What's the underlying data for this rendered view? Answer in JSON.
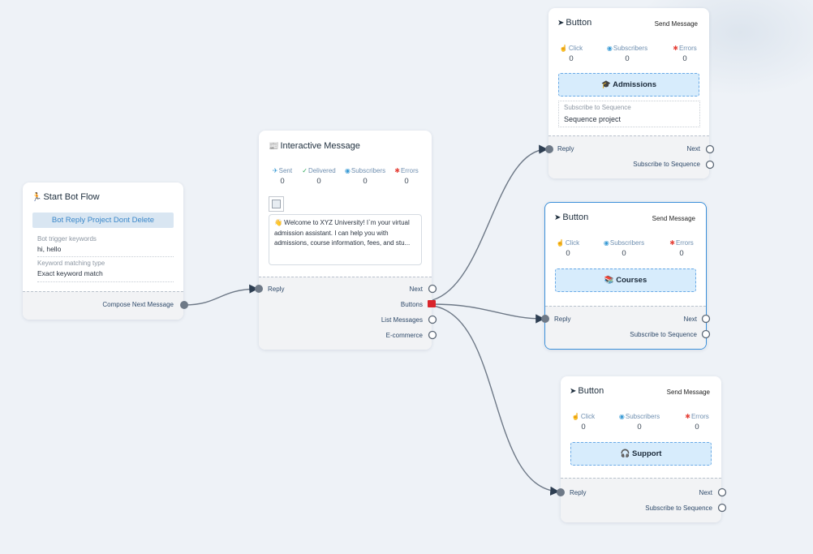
{
  "start_node": {
    "title": "Start Bot Flow",
    "icon": "walking-person-icon",
    "flow_label": "Bot Reply Project Dont Delete",
    "trigger_keywords_label": "Bot trigger keywords",
    "trigger_keywords_value": "hi, hello",
    "matching_type_label": "Keyword matching type",
    "matching_type_value": "Exact keyword match",
    "compose_next": "Compose Next Message"
  },
  "interactive_node": {
    "title": "Interactive Message",
    "icon": "newspaper-icon",
    "stats": [
      {
        "label": "Sent",
        "value": "0",
        "icon": "send-icon"
      },
      {
        "label": "Delivered",
        "value": "0",
        "icon": "check-circle-icon"
      },
      {
        "label": "Subscribers",
        "value": "0",
        "icon": "user-circle-icon"
      },
      {
        "label": "Errors",
        "value": "0",
        "icon": "bug-icon"
      }
    ],
    "message": "👋 Welcome to XYZ University! I`m your virtual admission assistant. I can help you with admissions, course information, fees, and stu...",
    "ports": {
      "reply": "Reply",
      "next": "Next",
      "buttons": "Buttons",
      "list_messages": "List Messages",
      "ecommerce": "E-commerce"
    }
  },
  "button_nodes": [
    {
      "title": "Button",
      "send_label": "Send Message",
      "button_text": "🎓 Admissions",
      "stats": [
        {
          "label": "Click",
          "value": "0"
        },
        {
          "label": "Subscribers",
          "value": "0"
        },
        {
          "label": "Errors",
          "value": "0"
        }
      ],
      "sequence_label": "Subscribe to Sequence",
      "sequence_value": "Sequence project",
      "reply": "Reply",
      "next": "Next",
      "subscribe": "Subscribe to Sequence"
    },
    {
      "title": "Button",
      "send_label": "Send Message",
      "button_text": "📚 Courses",
      "stats": [
        {
          "label": "Click",
          "value": "0"
        },
        {
          "label": "Subscribers",
          "value": "0"
        },
        {
          "label": "Errors",
          "value": "0"
        }
      ],
      "reply": "Reply",
      "next": "Next",
      "subscribe": "Subscribe to Sequence"
    },
    {
      "title": "Button",
      "send_label": "Send Message",
      "button_text": "🎧 Support",
      "stats": [
        {
          "label": "Click",
          "value": "0"
        },
        {
          "label": "Subscribers",
          "value": "0"
        },
        {
          "label": "Errors",
          "value": "0"
        }
      ],
      "reply": "Reply",
      "next": "Next",
      "subscribe": "Subscribe to Sequence"
    }
  ],
  "colors": {
    "accent": "#3b8fd9",
    "edge": "#6e7987",
    "port_active": "#d9252b",
    "button_fill": "#d7ecfc"
  }
}
